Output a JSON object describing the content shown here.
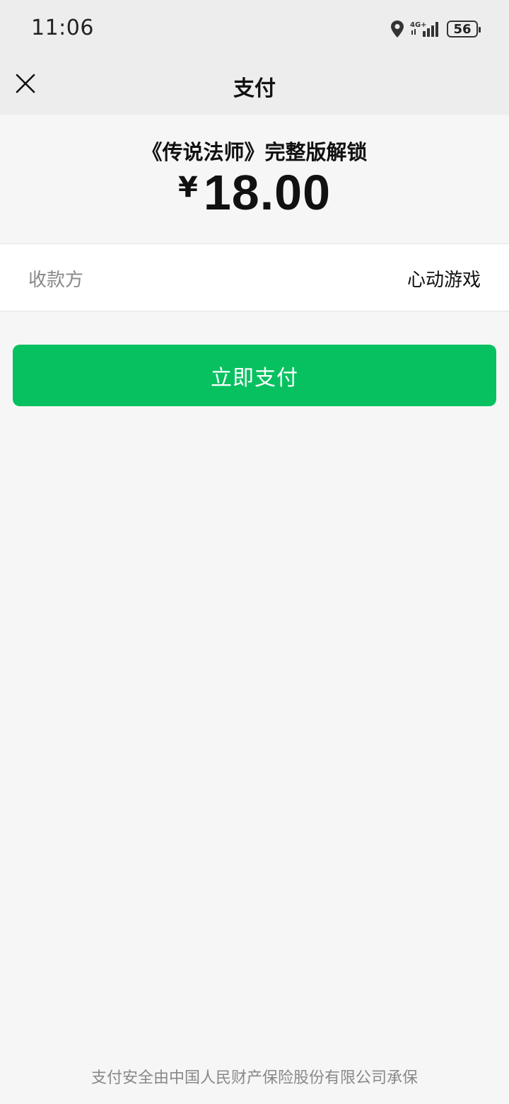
{
  "status_bar": {
    "time": "11:06",
    "network": "4G+",
    "battery": "56",
    "icons": [
      "location-icon",
      "signal-icon",
      "battery-icon"
    ]
  },
  "nav": {
    "title": "支付",
    "close_icon": "close-icon"
  },
  "product": {
    "name": "《传说法师》完整版解锁",
    "currency": "¥",
    "amount": "18.00"
  },
  "payee": {
    "label": "收款方",
    "value": "心动游戏"
  },
  "pay_button": {
    "label": "立即支付"
  },
  "footer": {
    "text": "支付安全由中国人民财产保险股份有限公司承保"
  },
  "colors": {
    "accent": "#07c160",
    "header_bg": "#ededed",
    "page_bg": "#f6f6f6"
  }
}
